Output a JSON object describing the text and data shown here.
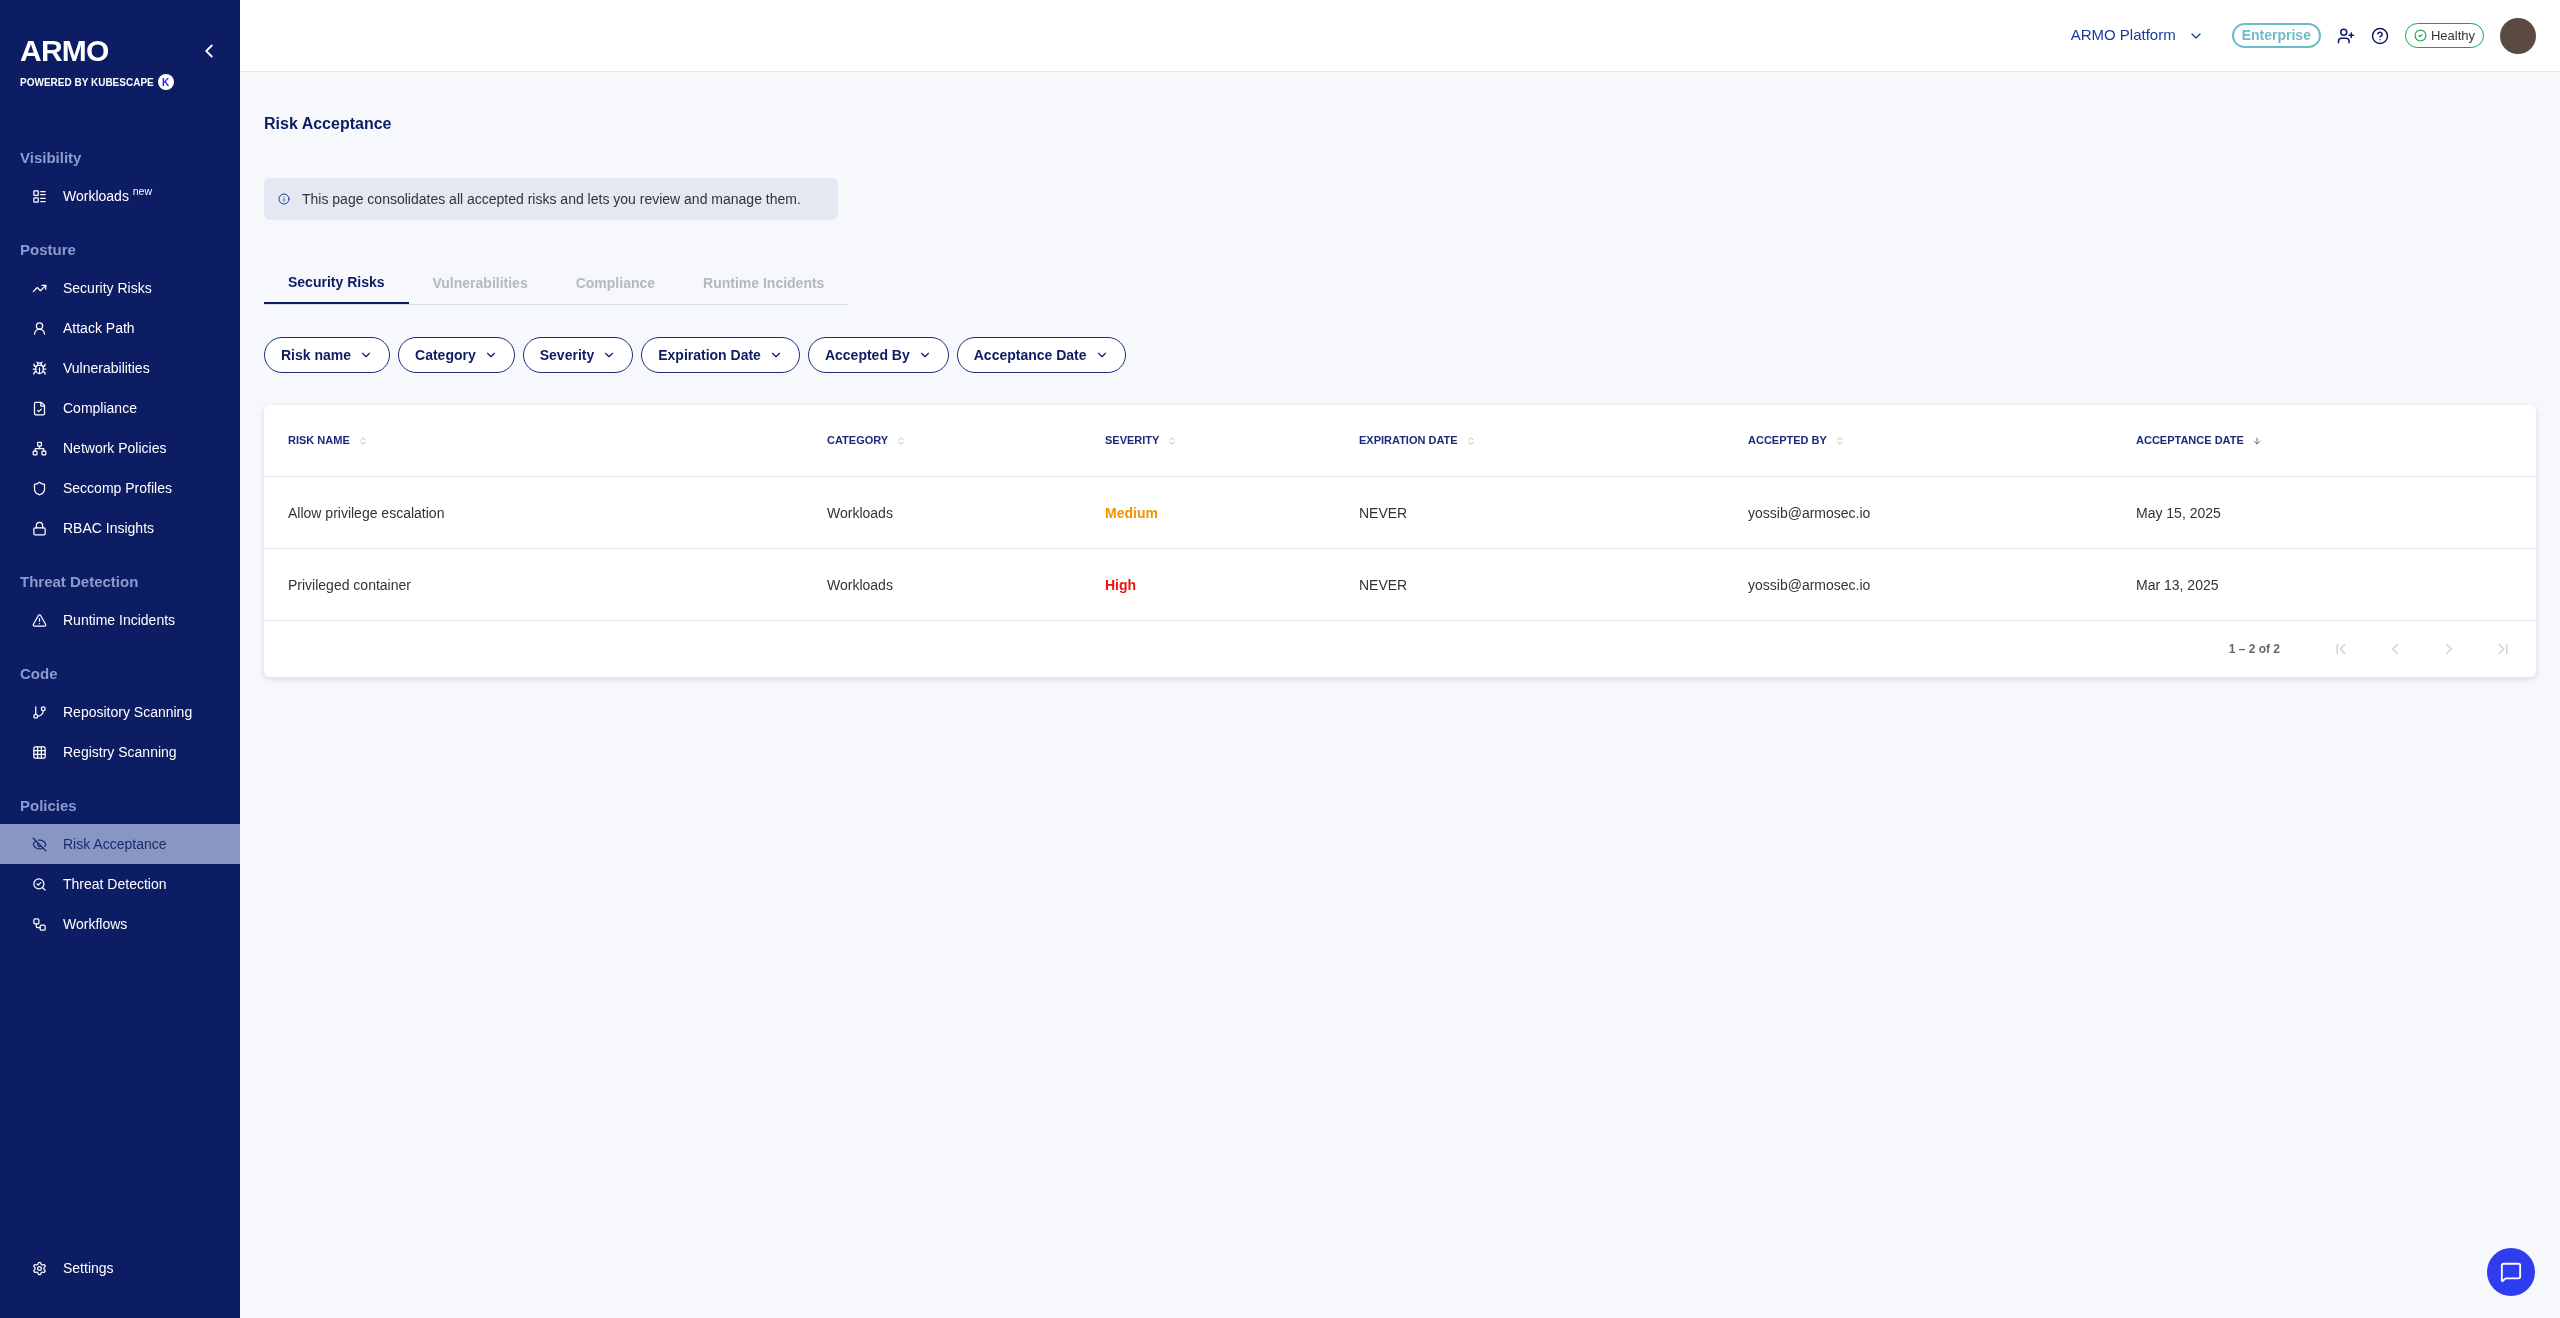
{
  "sidebar": {
    "logo": "ARMO",
    "powered_by": "POWERED BY KUBESCAPE",
    "badge": "K",
    "sections": [
      {
        "title": "Visibility",
        "items": [
          {
            "label": "Workloads $^{new}$",
            "selected": false
          }
        ]
      },
      {
        "title": "Posture",
        "items": [
          {
            "label": "Security Risks",
            "selected": false
          },
          {
            "label": "Attack Path",
            "selected": false
          },
          {
            "label": "Vulnerabilities",
            "selected": false
          },
          {
            "label": "Compliance",
            "selected": false
          },
          {
            "label": "Network Policies",
            "selected": false
          },
          {
            "label": "Seccomp Profiles",
            "selected": false
          },
          {
            "label": "RBAC Insights",
            "selected": false
          }
        ]
      },
      {
        "title": "Threat Detection",
        "items": [
          {
            "label": "Runtime Incidents",
            "selected": false
          }
        ]
      },
      {
        "title": "Code",
        "items": [
          {
            "label": "Repository Scanning",
            "selected": false
          },
          {
            "label": "Registry Scanning",
            "selected": false
          }
        ]
      },
      {
        "title": "Policies",
        "items": [
          {
            "label": "Risk Acceptance",
            "selected": true
          },
          {
            "label": "Threat Detection",
            "selected": false
          },
          {
            "label": "Workflows",
            "selected": false
          }
        ]
      }
    ],
    "settings": "Settings"
  },
  "header": {
    "platform": "ARMO Platform",
    "plan": "Enterprise",
    "status": "Healthy"
  },
  "page": {
    "title": "Risk Acceptance",
    "info": "This page consolidates all accepted risks and lets you review and manage them.",
    "tabs": [
      {
        "label": "Security Risks",
        "selected": true
      },
      {
        "label": "Vulnerabilities",
        "selected": false
      },
      {
        "label": "Compliance",
        "selected": false
      },
      {
        "label": "Runtime Incidents",
        "selected": false
      }
    ],
    "filters": [
      "Risk name",
      "Category",
      "Severity",
      "Expiration Date",
      "Accepted By",
      "Acceptance Date"
    ]
  },
  "table": {
    "columns": [
      {
        "label": "RISK NAME",
        "sorted": false
      },
      {
        "label": "CATEGORY",
        "sorted": false
      },
      {
        "label": "SEVERITY",
        "sorted": false
      },
      {
        "label": "EXPIRATION DATE",
        "sorted": false
      },
      {
        "label": "ACCEPTED BY",
        "sorted": false
      },
      {
        "label": "ACCEPTANCE DATE",
        "sorted": true
      }
    ],
    "rows": [
      {
        "risk_name": "Allow privilege escalation",
        "category": "Workloads",
        "severity": "Medium",
        "color": "#f39200",
        "expiration": "NEVER",
        "accepted_by": "yossib@armosec.io",
        "date": "May 15, 2025"
      },
      {
        "risk_name": "Privileged container",
        "category": "Workloads",
        "severity": "High",
        "color": "#ee1111",
        "expiration": "NEVER",
        "accepted_by": "yossib@armosec.io",
        "date": "Mar 13, 2025"
      }
    ],
    "range": "1 – 2 of 2",
    "pager": [
      {
        "kind": "first",
        "disabled": true
      },
      {
        "kind": "prev",
        "disabled": true
      },
      {
        "kind": "next",
        "disabled": true
      },
      {
        "kind": "last",
        "disabled": true
      }
    ]
  }
}
